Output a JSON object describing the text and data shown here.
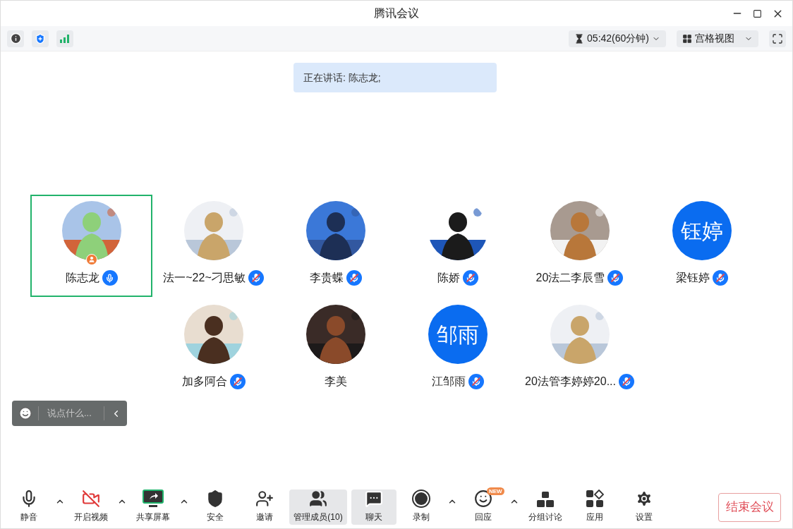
{
  "window": {
    "title": "腾讯会议"
  },
  "top_bar": {
    "timer": "05:42(60分钟)",
    "view": "宫格视图"
  },
  "speaking_banner": "正在讲话: 陈志龙;",
  "participants": [
    [
      {
        "name": "陈志龙",
        "mic_shown": true,
        "muted": false,
        "selected": true,
        "host": true
      },
      {
        "name": "法一~22~刁思敏",
        "mic_shown": true,
        "muted": true,
        "selected": false,
        "host": false
      },
      {
        "name": "李贵蝶",
        "mic_shown": true,
        "muted": true,
        "selected": false,
        "host": false
      },
      {
        "name": "陈娇",
        "mic_shown": true,
        "muted": true,
        "selected": false,
        "host": false
      },
      {
        "name": "20法二李辰雪",
        "mic_shown": true,
        "muted": true,
        "selected": false,
        "host": false
      },
      {
        "name": "梁钰婷",
        "avatar": {
          "kind": "initials",
          "text": "钰婷"
        },
        "mic_shown": true,
        "muted": true,
        "selected": false,
        "host": false
      }
    ],
    [
      {
        "name": "加多阿合",
        "mic_shown": true,
        "muted": true,
        "selected": false,
        "host": false
      },
      {
        "name": "李美",
        "mic_shown": false,
        "selected": false,
        "host": false
      },
      {
        "name": "江邹雨",
        "avatar": {
          "kind": "initials",
          "text": "邹雨"
        },
        "mic_shown": true,
        "muted": true,
        "selected": false,
        "host": false
      },
      {
        "name": "20法管李婷婷20...",
        "mic_shown": true,
        "muted": true,
        "selected": false,
        "host": false
      }
    ]
  ],
  "chat_input": {
    "placeholder": "说点什么..."
  },
  "toolbar": [
    {
      "label": "静音",
      "menu": true,
      "selected": false
    },
    {
      "label": "开启视频",
      "menu": true,
      "selected": false
    },
    {
      "label": "共享屏幕",
      "menu": true,
      "selected": false
    },
    {
      "label": "安全",
      "menu": false,
      "selected": false
    },
    {
      "label": "邀请",
      "menu": false,
      "selected": false
    },
    {
      "label": "管理成员(10)",
      "menu": false,
      "selected": true
    },
    {
      "label": "聊天",
      "menu": false,
      "selected": true
    },
    {
      "label": "录制",
      "menu": true,
      "selected": false
    },
    {
      "label": "回应",
      "menu": true,
      "selected": false,
      "badge": "NEW"
    },
    {
      "label": "分组讨论",
      "menu": false,
      "selected": false
    },
    {
      "label": "应用",
      "menu": false,
      "selected": false
    },
    {
      "label": "设置",
      "menu": false,
      "selected": false
    }
  ],
  "end_button": "结束会议"
}
